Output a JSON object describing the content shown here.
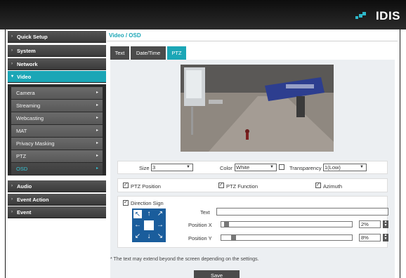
{
  "brand": {
    "logo_text": "IDIS",
    "accent": "#1ba6b6"
  },
  "sidebar": {
    "menus": [
      {
        "label": "Quick Setup"
      },
      {
        "label": "System"
      },
      {
        "label": "Network"
      },
      {
        "label": "Video"
      },
      {
        "label": "Audio"
      },
      {
        "label": "Event Action"
      },
      {
        "label": "Event"
      }
    ],
    "video_submenu": [
      {
        "label": "Camera"
      },
      {
        "label": "Streaming"
      },
      {
        "label": "Webcasting"
      },
      {
        "label": "MAT"
      },
      {
        "label": "Privacy Masking"
      },
      {
        "label": "PTZ"
      },
      {
        "label": "OSD"
      }
    ],
    "active_menu": "Video",
    "active_submenu": "OSD"
  },
  "main": {
    "page_title": "Video / OSD",
    "tabs": [
      {
        "label": "Text"
      },
      {
        "label": "Date/Time"
      },
      {
        "label": "PTZ"
      }
    ],
    "active_tab": "PTZ",
    "style": {
      "size_label": "Size",
      "size_value": "3",
      "color_label": "Color",
      "color_value": "White",
      "transparency_label": "Transparency",
      "transparency_value": "1(Low)"
    },
    "options": {
      "ptz_position": "PTZ Position",
      "ptz_function": "PTZ Function",
      "azimuth": "Azimuth"
    },
    "direction": {
      "label": "Direction Sign",
      "text_label": "Text",
      "text_value": "",
      "pos_x_label": "Position X",
      "pos_x_value": "2%",
      "pos_x_level": 0.02,
      "pos_y_label": "Position Y",
      "pos_y_value": "8%",
      "pos_y_level": 0.08
    },
    "note": "* The text may extend beyond the screen depending on the settings.",
    "save_label": "Save"
  }
}
